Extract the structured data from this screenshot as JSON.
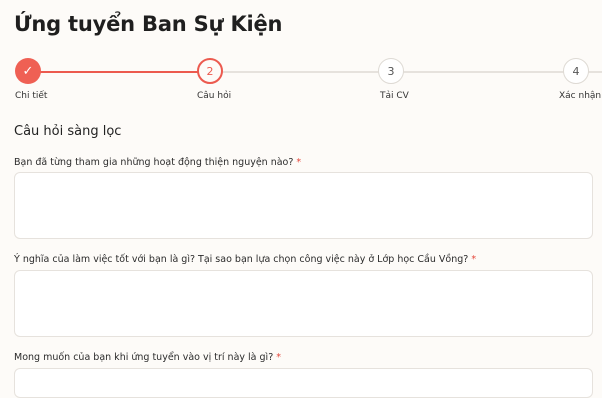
{
  "page": {
    "title": "Ứng tuyển Ban Sự Kiện"
  },
  "stepper": {
    "steps": [
      {
        "marker": "✓",
        "label": "Chi tiết",
        "state": "completed"
      },
      {
        "marker": "2",
        "label": "Câu hỏi",
        "state": "current"
      },
      {
        "marker": "3",
        "label": "Tải CV",
        "state": "upcoming"
      },
      {
        "marker": "4",
        "label": "Xác nhận",
        "state": "upcoming"
      }
    ],
    "accent_color": "#ec5a4f"
  },
  "form": {
    "section_title": "Câu hỏi sàng lọc",
    "required_mark": "*",
    "questions": [
      {
        "label": "Bạn đã từng tham gia những hoạt động thiện nguyện nào?",
        "value": ""
      },
      {
        "label": "Ý nghĩa của làm việc tốt với bạn là gì? Tại sao bạn lựa chọn công việc này ở Lớp học Cầu Vồng?",
        "value": ""
      },
      {
        "label": "Mong muốn của bạn khi ứng tuyển vào vị trí này là gì?",
        "value": ""
      }
    ]
  }
}
